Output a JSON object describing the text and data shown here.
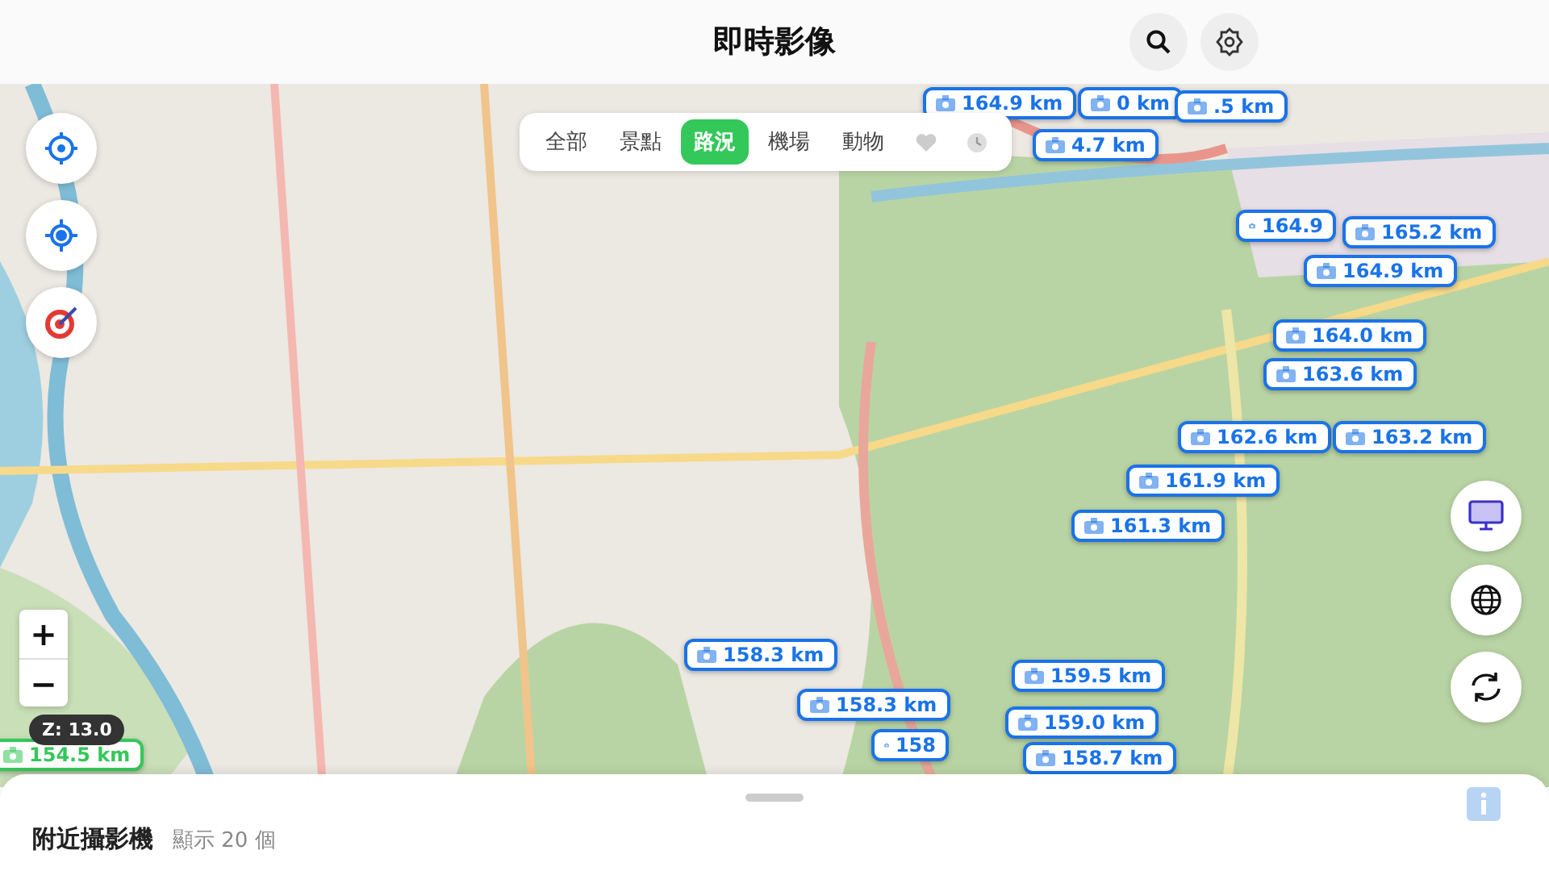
{
  "header": {
    "title": "即時影像"
  },
  "categories": [
    {
      "label": "全部",
      "selected": false
    },
    {
      "label": "景點",
      "selected": false
    },
    {
      "label": "路況",
      "selected": true
    },
    {
      "label": "機場",
      "selected": false
    },
    {
      "label": "動物",
      "selected": false
    }
  ],
  "category_icons": [
    {
      "kind": "heart",
      "selected": false
    },
    {
      "kind": "clock",
      "selected": false
    }
  ],
  "zoom": {
    "badge": "Z: 13.0",
    "zoom_in": "+",
    "zoom_out": "−"
  },
  "markers": [
    {
      "label": "164.9 km",
      "color": "#1a73e8"
    },
    {
      "label": "0 km",
      "color": "#1a73e8"
    },
    {
      "label": ".5 km",
      "color": "#1a73e8"
    },
    {
      "label": "4.7 km",
      "color": "#1a73e8"
    },
    {
      "label": "164.9",
      "color": "#1a73e8"
    },
    {
      "label": "165.2 km",
      "color": "#1a73e8"
    },
    {
      "label": "164.9 km",
      "color": "#1a73e8"
    },
    {
      "label": "164.0 km",
      "color": "#1a73e8"
    },
    {
      "label": "163.6 km",
      "color": "#1a73e8"
    },
    {
      "label": "162.6 km",
      "color": "#1a73e8"
    },
    {
      "label": "163.2 km",
      "color": "#1a73e8"
    },
    {
      "label": "161.9 km",
      "color": "#1a73e8"
    },
    {
      "label": "161.3 km",
      "color": "#1a73e8"
    },
    {
      "label": "158.3 km",
      "color": "#1a73e8"
    },
    {
      "label": "159.5 km",
      "color": "#1a73e8"
    },
    {
      "label": "158.3 km",
      "color": "#1a73e8"
    },
    {
      "label": "159.0 km",
      "color": "#1a73e8"
    },
    {
      "label": "158",
      "color": "#1a73e8"
    },
    {
      "label": "154.5 km",
      "color": "#34c759"
    },
    {
      "label": "158.7 km",
      "color": "#1a73e8"
    }
  ],
  "sheet": {
    "title": "附近攝影機",
    "count": "顯示 20 個"
  }
}
